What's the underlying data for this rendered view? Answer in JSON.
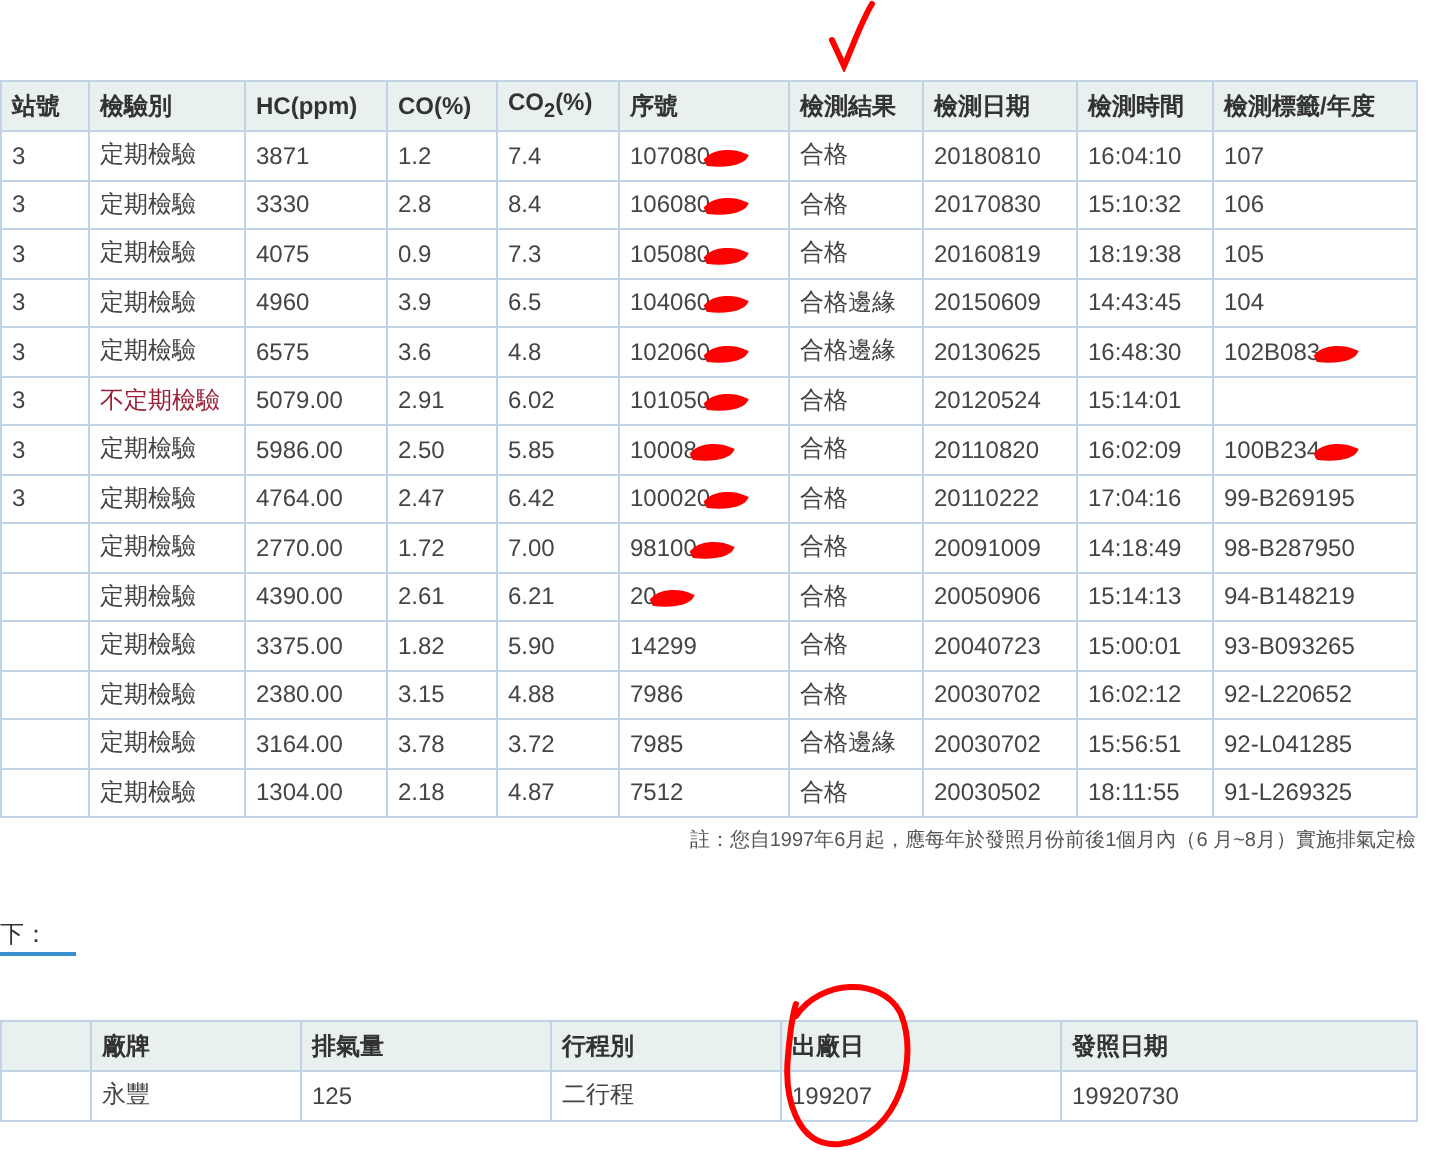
{
  "records_table": {
    "columns": [
      "站號",
      "檢驗別",
      "HC(ppm)",
      "CO(%)",
      "CO$_{2}$(%)",
      "序號",
      "檢測結果",
      "檢測日期",
      "檢測時間",
      "檢測標籤/年度"
    ],
    "rows": [
      {
        "station": "3",
        "kind": "regular",
        "type": "定期檢驗",
        "hc": "3871",
        "co": "1.2",
        "co2": "7.4",
        "serial": "107080",
        "redacted": true,
        "result": "合格",
        "date": "20180810",
        "time": "16:04:10",
        "tag": "107"
      },
      {
        "station": "3",
        "kind": "regular",
        "type": "定期檢驗",
        "hc": "3330",
        "co": "2.8",
        "co2": "8.4",
        "serial": "106080",
        "redacted": true,
        "result": "合格",
        "date": "20170830",
        "time": "15:10:32",
        "tag": "106"
      },
      {
        "station": "3",
        "kind": "regular",
        "type": "定期檢驗",
        "hc": "4075",
        "co": "0.9",
        "co2": "7.3",
        "serial": "105080",
        "redacted": true,
        "result": "合格",
        "date": "20160819",
        "time": "18:19:38",
        "tag": "105"
      },
      {
        "station": "3",
        "kind": "regular",
        "type": "定期檢驗",
        "hc": "4960",
        "co": "3.9",
        "co2": "6.5",
        "serial": "104060",
        "redacted": true,
        "result": "合格邊緣",
        "date": "20150609",
        "time": "14:43:45",
        "tag": "104"
      },
      {
        "station": "3",
        "kind": "regular",
        "type": "定期檢驗",
        "hc": "6575",
        "co": "3.6",
        "co2": "4.8",
        "serial": "102060",
        "redacted": true,
        "result": "合格邊緣",
        "date": "20130625",
        "time": "16:48:30",
        "tag": "102B083",
        "tag_redacted": true
      },
      {
        "station": "3",
        "kind": "irregular",
        "type": "不定期檢驗",
        "hc": "5079.00",
        "co": "2.91",
        "co2": "6.02",
        "serial": "101050",
        "redacted": true,
        "result": "合格",
        "date": "20120524",
        "time": "15:14:01"
      },
      {
        "station": "3",
        "kind": "regular",
        "type": "定期檢驗",
        "hc": "5986.00",
        "co": "2.50",
        "co2": "5.85",
        "serial": "10008",
        "redacted": true,
        "result": "合格",
        "date": "20110820",
        "time": "16:02:09",
        "tag": "100B234",
        "tag_redacted": true
      },
      {
        "station": "3",
        "kind": "regular",
        "type": "定期檢驗",
        "hc": "4764.00",
        "co": "2.47",
        "co2": "6.42",
        "serial": "100020",
        "redacted": true,
        "result": "合格",
        "date": "20110222",
        "time": "17:04:16",
        "tag": "99-B269195"
      },
      {
        "kind": "regular",
        "type": "定期檢驗",
        "hc": "2770.00",
        "co": "1.72",
        "co2": "7.00",
        "serial": "98100",
        "redacted": true,
        "result": "合格",
        "date": "20091009",
        "time": "14:18:49",
        "tag": "98-B287950"
      },
      {
        "kind": "regular",
        "type": "定期檢驗",
        "hc": "4390.00",
        "co": "2.61",
        "co2": "6.21",
        "serial": "20",
        "redacted": true,
        "result": "合格",
        "date": "20050906",
        "time": "15:14:13",
        "tag": "94-B148219"
      },
      {
        "kind": "regular",
        "type": "定期檢驗",
        "hc": "3375.00",
        "co": "1.82",
        "co2": "5.90",
        "serial": "14299",
        "result": "合格",
        "date": "20040723",
        "time": "15:00:01",
        "tag": "93-B093265"
      },
      {
        "kind": "regular",
        "type": "定期檢驗",
        "hc": "2380.00",
        "co": "3.15",
        "co2": "4.88",
        "serial": "7986",
        "result": "合格",
        "date": "20030702",
        "time": "16:02:12",
        "tag": "92-L220652"
      },
      {
        "kind": "regular",
        "type": "定期檢驗",
        "hc": "3164.00",
        "co": "3.78",
        "co2": "3.72",
        "serial": "7985",
        "result": "合格邊緣",
        "date": "20030702",
        "time": "15:56:51",
        "tag": "92-L041285"
      },
      {
        "kind": "regular",
        "type": "定期檢驗",
        "hc": "1304.00",
        "co": "2.18",
        "co2": "4.87",
        "serial": "7512",
        "result": "合格",
        "date": "20030502",
        "time": "18:11:55",
        "tag": "91-L269325"
      }
    ]
  },
  "note": "註：您自1997年6月起，應每年於發照月份前後1個月內（6 月~8月）實施排氣定檢",
  "link": "下：",
  "vehicle_table": {
    "columns": [
      "",
      "廠牌",
      "排氣量",
      "行程別",
      "出廠日",
      "發照日期"
    ],
    "rows": [
      [
        "",
        "永豐",
        "125",
        "二行程",
        "199207",
        "19920730"
      ]
    ]
  }
}
